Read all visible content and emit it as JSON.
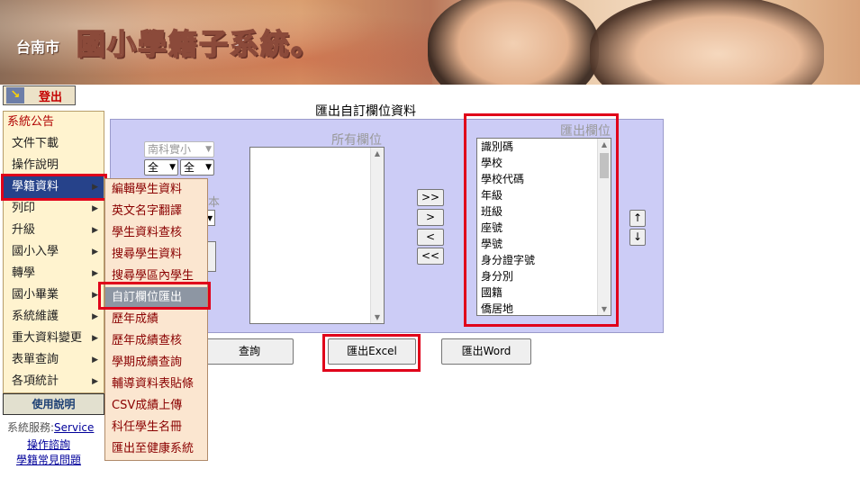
{
  "banner": {
    "city": "台南市",
    "title": "國小學籍子系統。"
  },
  "logout": {
    "label": "登出"
  },
  "left_menu": {
    "items": [
      {
        "label": "系統公告",
        "arrow": ""
      },
      {
        "label": "文件下載",
        "arrow": ""
      },
      {
        "label": "操作說明",
        "arrow": ""
      },
      {
        "label": "學籍資料",
        "arrow": "▶"
      },
      {
        "label": "列印",
        "arrow": "▶"
      },
      {
        "label": "升級",
        "arrow": "▶"
      },
      {
        "label": "國小入學",
        "arrow": "▶"
      },
      {
        "label": "轉學",
        "arrow": "▶"
      },
      {
        "label": "國小畢業",
        "arrow": "▶"
      },
      {
        "label": "系統維護",
        "arrow": "▶"
      },
      {
        "label": "重大資料變更",
        "arrow": "▶"
      },
      {
        "label": "表單查詢",
        "arrow": "▶"
      },
      {
        "label": "各項統計",
        "arrow": "▶"
      }
    ],
    "help_label": "使用說明",
    "service_prefix": "系統服務:",
    "service_link": "Service",
    "link1": "操作諮詢",
    "link2": "學籍常見問題"
  },
  "submenu": {
    "items": [
      "編輯學生資料",
      "英文名字翻譯",
      "學生資料查核",
      "搜尋學生資料",
      "搜尋學區內學生",
      "自訂欄位匯出",
      "歷年成績",
      "歷年成績查核",
      "學期成績查詢",
      "輔導資料表貼條",
      "CSV成績上傳",
      "科任學生名冊",
      "匯出至健康系統"
    ]
  },
  "page": {
    "title": "匯出自訂欄位資料",
    "school_select": "南科實小",
    "grade_select": "全",
    "class_select": "全",
    "obscured_text": "本",
    "all_fields_label": "所有欄位",
    "export_fields_label": "匯出欄位",
    "export_fields": [
      "識別碼",
      "學校",
      "學校代碼",
      "年級",
      "班級",
      "座號",
      "學號",
      "身分證字號",
      "身分別",
      "國籍",
      "僑居地"
    ],
    "move_buttons": [
      ">>",
      ">",
      "<",
      "<<"
    ],
    "order_buttons": [
      "↑",
      "↓"
    ],
    "query_button": "查詢",
    "excel_button": "匯出Excel",
    "word_button": "匯出Word"
  },
  "colors": {
    "highlight_red": "#e0001a",
    "panel_lavender": "#ccccf6",
    "menu_bg": "#fff3cf",
    "submenu_bg": "#fbe6d0",
    "menu_active": "#26428a"
  },
  "icons": {
    "logout": "logout-arrow-icon",
    "menu_arrow": "triangle-right-icon"
  }
}
